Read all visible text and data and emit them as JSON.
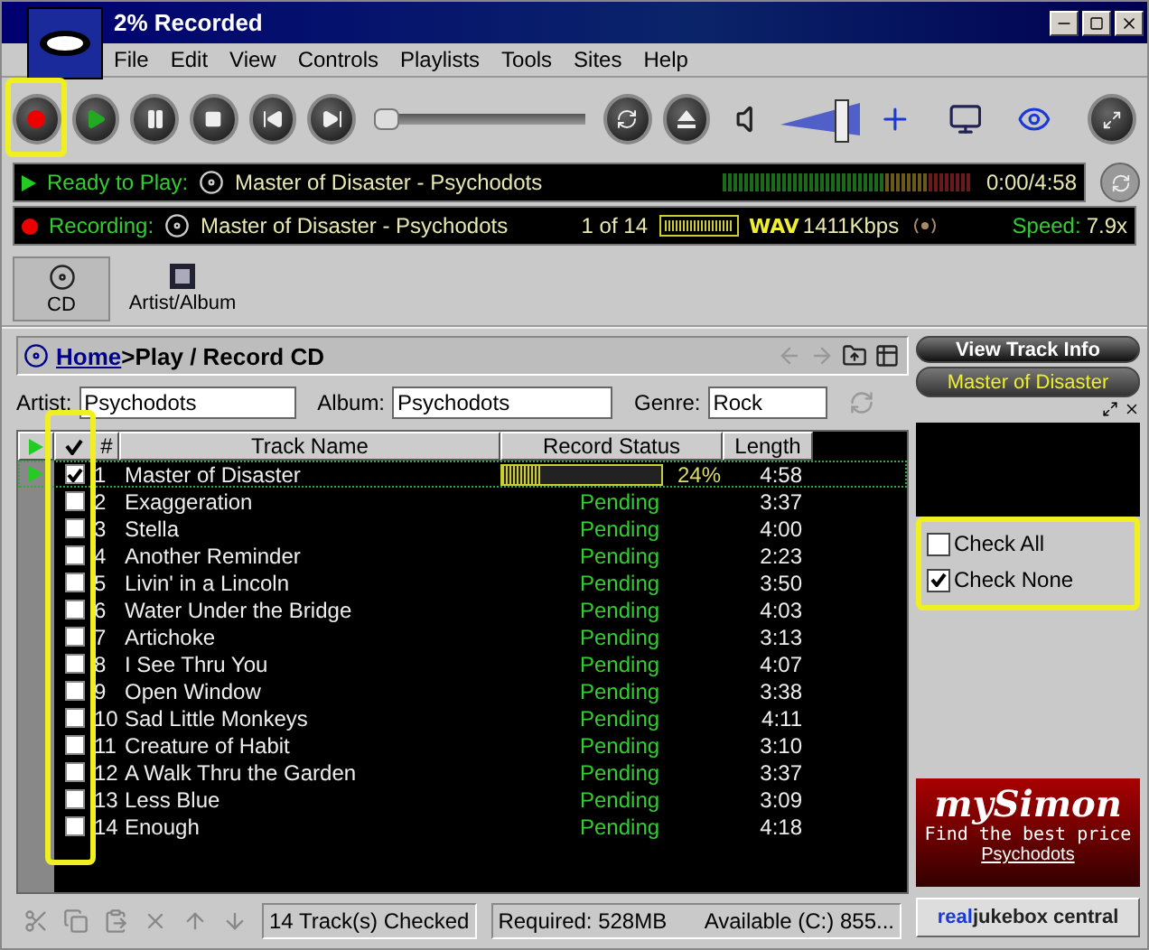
{
  "window": {
    "title": "2% Recorded"
  },
  "menu": [
    "File",
    "Edit",
    "View",
    "Controls",
    "Playlists",
    "Tools",
    "Sites",
    "Help"
  ],
  "volume": {
    "level": 0.8
  },
  "seek": {
    "level": 0
  },
  "now_playing": {
    "status": "Ready to Play:",
    "track": "Master of Disaster - Psychodots",
    "time": "0:00/4:58"
  },
  "recording": {
    "status": "Recording:",
    "track": "Master of Disaster - Psychodots",
    "position": "1 of 14",
    "format": "WAV",
    "bitrate": "1411Kbps",
    "speed_label": "Speed:",
    "speed": "7.9x"
  },
  "tabs": [
    {
      "label": "CD",
      "selected": true
    },
    {
      "label": "Artist/Album",
      "selected": false
    }
  ],
  "breadcrumb": {
    "link": "Home",
    "path": ">Play / Record CD"
  },
  "fields": [
    {
      "label": "Artist:",
      "value": "Psychodots"
    },
    {
      "label": "Album:",
      "value": "Psychodots"
    },
    {
      "label": "Genre:",
      "value": "Rock"
    }
  ],
  "table": {
    "columns": [
      "#",
      "Track Name",
      "Record Status",
      "Length"
    ],
    "rows": [
      {
        "number": "1",
        "name": "Master of Disaster",
        "checked": true,
        "playing": true,
        "kind": "progress",
        "level": 0.24,
        "status": "24%",
        "length": "4:58"
      },
      {
        "number": "2",
        "name": "Exaggeration",
        "checked": false,
        "playing": false,
        "kind": "text",
        "status": "Pending",
        "length": "3:37"
      },
      {
        "number": "3",
        "name": "Stella",
        "checked": false,
        "playing": false,
        "kind": "text",
        "status": "Pending",
        "length": "4:00"
      },
      {
        "number": "4",
        "name": "Another Reminder",
        "checked": false,
        "playing": false,
        "kind": "text",
        "status": "Pending",
        "length": "2:23"
      },
      {
        "number": "5",
        "name": "Livin' in a Lincoln",
        "checked": false,
        "playing": false,
        "kind": "text",
        "status": "Pending",
        "length": "3:50"
      },
      {
        "number": "6",
        "name": "Water Under the Bridge",
        "checked": false,
        "playing": false,
        "kind": "text",
        "status": "Pending",
        "length": "4:03"
      },
      {
        "number": "7",
        "name": "Artichoke",
        "checked": false,
        "playing": false,
        "kind": "text",
        "status": "Pending",
        "length": "3:13"
      },
      {
        "number": "8",
        "name": "I See Thru You",
        "checked": false,
        "playing": false,
        "kind": "text",
        "status": "Pending",
        "length": "4:07"
      },
      {
        "number": "9",
        "name": "Open Window",
        "checked": false,
        "playing": false,
        "kind": "text",
        "status": "Pending",
        "length": "3:38"
      },
      {
        "number": "10",
        "name": "Sad Little Monkeys",
        "checked": false,
        "playing": false,
        "kind": "text",
        "status": "Pending",
        "length": "4:11"
      },
      {
        "number": "11",
        "name": "Creature of Habit",
        "checked": false,
        "playing": false,
        "kind": "text",
        "status": "Pending",
        "length": "3:10"
      },
      {
        "number": "12",
        "name": "A Walk Thru the Garden",
        "checked": false,
        "playing": false,
        "kind": "text",
        "status": "Pending",
        "length": "3:37"
      },
      {
        "number": "13",
        "name": "Less Blue",
        "checked": false,
        "playing": false,
        "kind": "text",
        "status": "Pending",
        "length": "3:09"
      },
      {
        "number": "14",
        "name": "Enough",
        "checked": false,
        "playing": false,
        "kind": "text",
        "status": "Pending",
        "length": "4:18"
      }
    ]
  },
  "side_panel": {
    "button": "View Track Info",
    "now_playing": "Master of Disaster",
    "options": [
      {
        "label": "Check All",
        "checked": false
      },
      {
        "label": "Check None",
        "checked": true
      }
    ],
    "ad": {
      "brand": "mySimon",
      "tagline": "Find the best price",
      "link": "Psychodots"
    },
    "central": {
      "prefix": "real",
      "rest": "jukebox central"
    }
  },
  "status_bar": {
    "checked": "14 Track(s) Checked",
    "required": "Required: 528MB",
    "available": "Available (C:) 855..."
  }
}
